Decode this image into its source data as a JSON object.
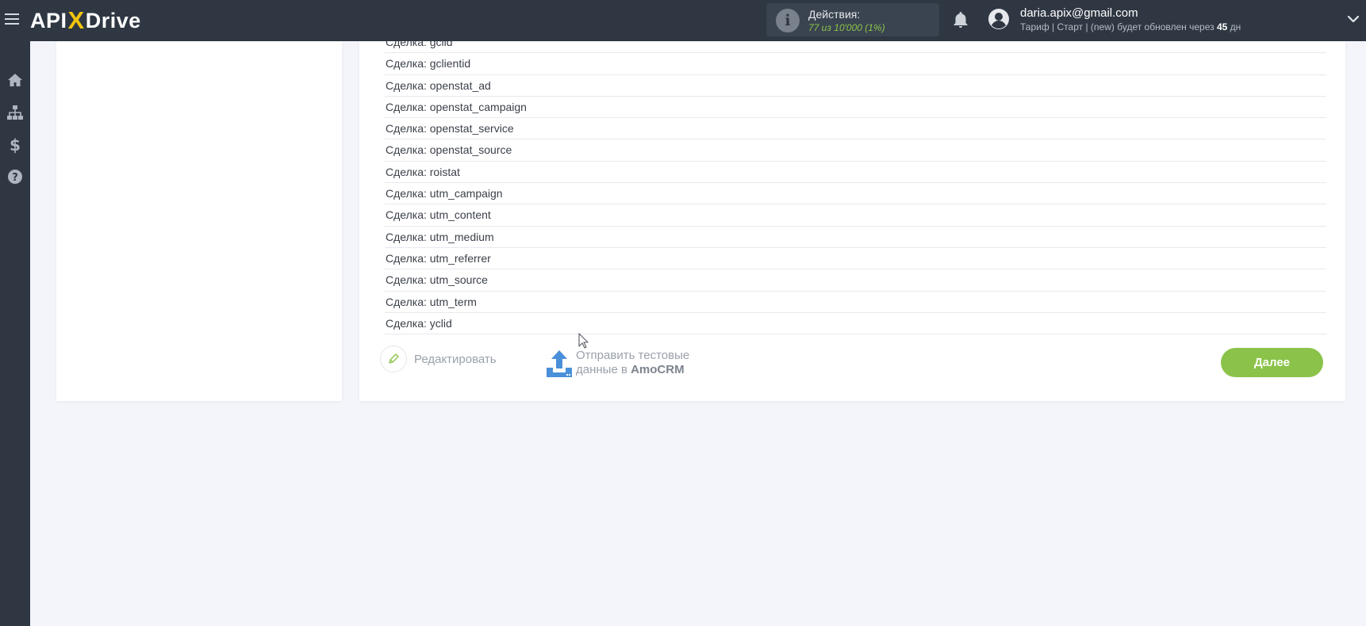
{
  "header": {
    "logo_left": "API",
    "logo_x": "X",
    "logo_right": "Drive",
    "actions_label": "Действия:",
    "actions_count": "77 из 10'000 (1%)",
    "user_email": "daria.apix@gmail.com",
    "plan_text": "Тариф | Старт | (new) будет обновлен через ",
    "plan_days": "45",
    "plan_unit": " дн"
  },
  "sidebar": {
    "items": [
      {
        "icon": "home-icon"
      },
      {
        "icon": "sitemap-icon"
      },
      {
        "icon": "dollar-icon"
      },
      {
        "icon": "help-icon"
      }
    ]
  },
  "fields": [
    "Сделка: gclid",
    "Сделка: gclientid",
    "Сделка: openstat_ad",
    "Сделка: openstat_campaign",
    "Сделка: openstat_service",
    "Сделка: openstat_source",
    "Сделка: roistat",
    "Сделка: utm_campaign",
    "Сделка: utm_content",
    "Сделка: utm_medium",
    "Сделка: utm_referrer",
    "Сделка: utm_source",
    "Сделка: utm_term",
    "Сделка: yclid"
  ],
  "actions": {
    "edit_label": "Редактировать",
    "send_line1": "Отправить тестовые",
    "send_line2": "данные в ",
    "send_target": "AmoCRM",
    "next_label": "Далее"
  },
  "colors": {
    "topbar": "#2e3742",
    "accent_green": "#8bc34a",
    "logo_x": "#f1c40f",
    "background": "#f3f5fb"
  }
}
